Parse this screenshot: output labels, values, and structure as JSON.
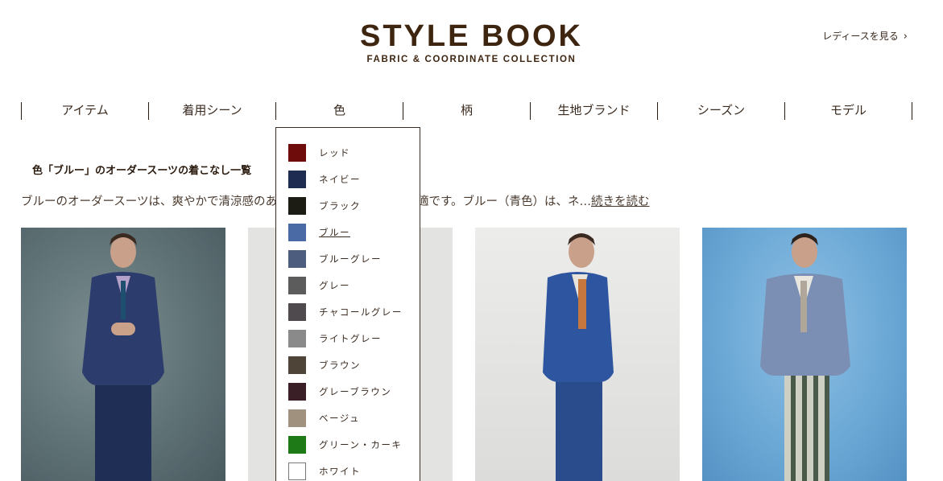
{
  "header": {
    "logo_main": "STYLE BOOK",
    "logo_sub": "FABRIC & COORDINATE COLLECTION",
    "ladies_link": "レディースを見る",
    "ladies_chevron": "›"
  },
  "nav": {
    "items": [
      {
        "label": "アイテム"
      },
      {
        "label": "着用シーン"
      },
      {
        "label": "色"
      },
      {
        "label": "柄"
      },
      {
        "label": "生地ブランド"
      },
      {
        "label": "シーズン"
      },
      {
        "label": "モデル"
      }
    ]
  },
  "page": {
    "heading": "色「ブルー」のオーダースーツの着こなし一覧",
    "intro": "ブルーのオーダースーツは、爽やかで清涼感のある印象を演出したい際に最適です。ブルー（青色）は、ネ…",
    "read_more": "続きを読む"
  },
  "color_menu": {
    "active": "ブルー",
    "items": [
      {
        "label": "レッド",
        "color": "#6e0b0b"
      },
      {
        "label": "ネイビー",
        "color": "#1f2c52"
      },
      {
        "label": "ブラック",
        "color": "#1c1c14"
      },
      {
        "label": "ブルー",
        "color": "#4a6aa6"
      },
      {
        "label": "ブルーグレー",
        "color": "#4d5d7e"
      },
      {
        "label": "グレー",
        "color": "#5c5c5c"
      },
      {
        "label": "チャコールグレー",
        "color": "#4e4a4e"
      },
      {
        "label": "ライトグレー",
        "color": "#8a8a8a"
      },
      {
        "label": "ブラウン",
        "color": "#4f4438"
      },
      {
        "label": "グレーブラウン",
        "color": "#3b1f26"
      },
      {
        "label": "ベージュ",
        "color": "#a0917e"
      },
      {
        "label": "グリーン・カーキ",
        "color": "#1e7a17"
      },
      {
        "label": "ホワイト",
        "color": "#ffffff"
      }
    ]
  }
}
